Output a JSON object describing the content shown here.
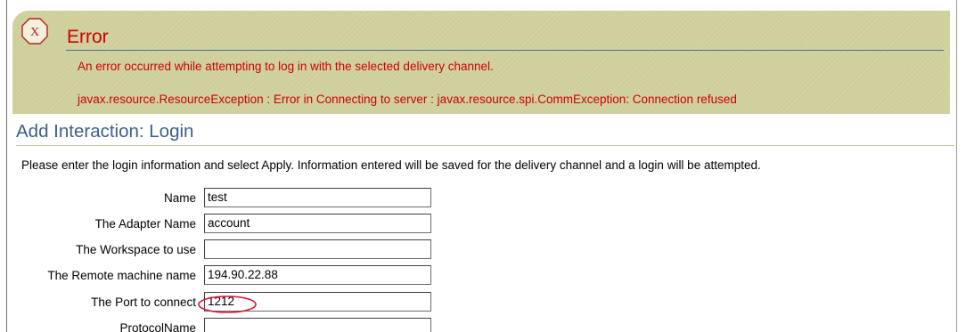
{
  "error": {
    "icon": "error-x-icon",
    "title": "Error",
    "message": "An error occurred while attempting to log in with the selected delivery channel.",
    "detail": "javax.resource.ResourceException : Error in Connecting to server : javax.resource.spi.CommException: Connection refused"
  },
  "page": {
    "title": "Add Interaction: Login",
    "instructions": "Please enter the login information and select Apply. Information entered will be saved for the delivery channel and a login will be attempted."
  },
  "form": {
    "fields": [
      {
        "label": "Name",
        "value": "test"
      },
      {
        "label": "The Adapter Name",
        "value": "account"
      },
      {
        "label": "The Workspace to use",
        "value": ""
      },
      {
        "label": "The Remote machine name",
        "value": "194.90.22.88"
      },
      {
        "label": "The Port to connect",
        "value": "1212"
      },
      {
        "label": "ProtocolName",
        "value": ""
      }
    ]
  },
  "colors": {
    "error_banner": "#cfcf9c",
    "error_text": "#cc0000",
    "heading_text": "#3b5f8a",
    "annotation": "#e0102a"
  }
}
